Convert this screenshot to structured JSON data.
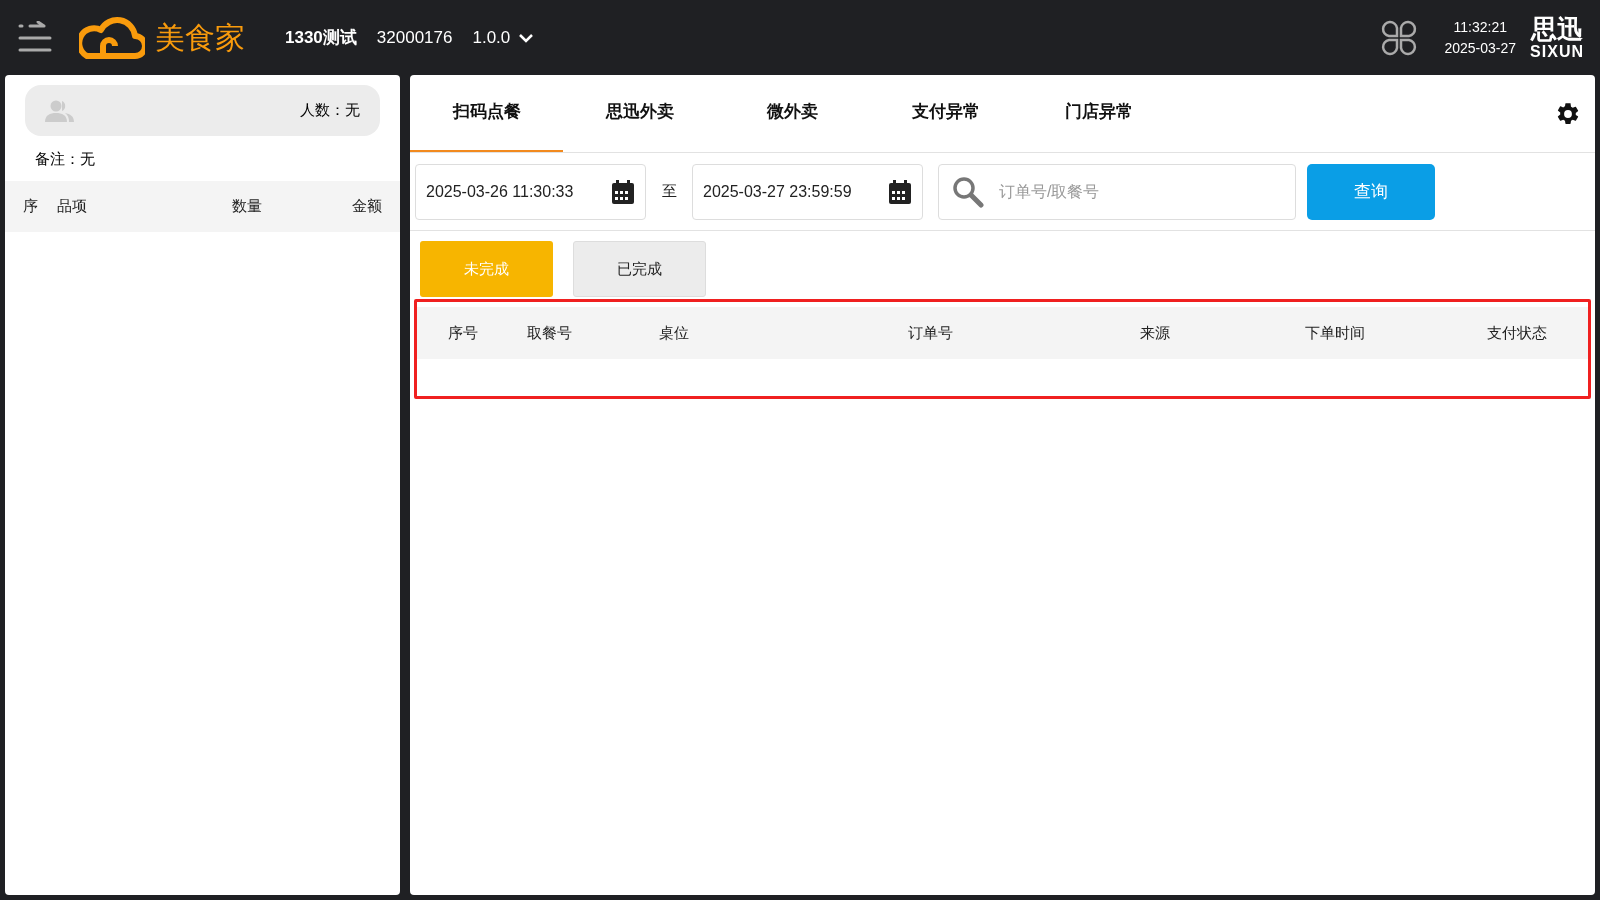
{
  "header": {
    "brand": "美食家",
    "store": "1330测试",
    "store_code": "32000176",
    "version": "1.0.0",
    "time": "11:32:21",
    "date": "2025-03-27",
    "vendor_name": "思迅",
    "vendor_latin": "SIXUN"
  },
  "order_panel": {
    "guests": "人数：无",
    "note": "备注：无",
    "columns": [
      "序",
      "品项",
      "数量",
      "金额"
    ]
  },
  "tabs": [
    {
      "label": "扫码点餐",
      "selected": true
    },
    {
      "label": "思迅外卖",
      "selected": false
    },
    {
      "label": "微外卖",
      "selected": false
    },
    {
      "label": "支付异常",
      "selected": false
    },
    {
      "label": "门店异常",
      "selected": false
    }
  ],
  "filter": {
    "start": "2025-03-26 11:30:33",
    "separator": "至",
    "end": "2025-03-27 23:59:59",
    "search_placeholder": "订单号/取餐号",
    "query_button": "查询"
  },
  "status_buttons": [
    {
      "label": "未完成",
      "selected": true
    },
    {
      "label": "已完成",
      "selected": false
    }
  ],
  "table": {
    "columns": [
      "序号",
      "取餐号",
      "桌位",
      "订单号",
      "来源",
      "下单时间",
      "支付状态"
    ]
  }
}
